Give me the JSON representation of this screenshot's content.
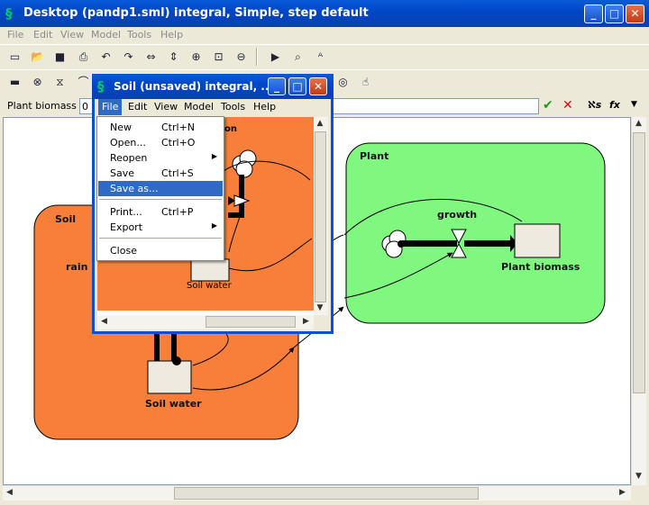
{
  "window": {
    "title": "Desktop (pandp1.sml) integral, Simple, step default",
    "controls": {
      "minimize": "_",
      "maximize": "□",
      "close": "✕"
    }
  },
  "menubar": [
    "File",
    "Edit",
    "View",
    "Model",
    "Tools",
    "Help"
  ],
  "formula": {
    "label": "Plant biomass =",
    "value": "0",
    "accept": "✔",
    "reject": "✕",
    "sigma": "ℵs",
    "fx": "fx"
  },
  "diagram": {
    "soil": {
      "title": "Soil",
      "rain": "rain",
      "water": "Soil water"
    },
    "plant": {
      "title": "Plant",
      "growth": "growth",
      "biomass": "Plant biomass"
    }
  },
  "child": {
    "title": "Soil (unsaved) integral, ...",
    "menu": [
      "File",
      "Edit",
      "View",
      "Model",
      "Tools",
      "Help"
    ],
    "inner_text": "ation",
    "soil_water": "Soil water"
  },
  "file_menu": {
    "items": [
      {
        "label": "New",
        "shortcut": "Ctrl+N"
      },
      {
        "label": "Open...",
        "shortcut": "Ctrl+O"
      },
      {
        "label": "Reopen",
        "shortcut": "",
        "submenu": true
      },
      {
        "label": "Save",
        "shortcut": "Ctrl+S"
      },
      {
        "label": "Save as...",
        "shortcut": "",
        "highlighted": true
      },
      {
        "label": "Print...",
        "shortcut": "Ctrl+P"
      },
      {
        "label": "Export",
        "shortcut": "",
        "submenu": true
      },
      {
        "label": "Close",
        "shortcut": ""
      }
    ]
  },
  "colors": {
    "soil": "#f77f3a",
    "plant": "#80f880",
    "selection": "#316ac5"
  }
}
